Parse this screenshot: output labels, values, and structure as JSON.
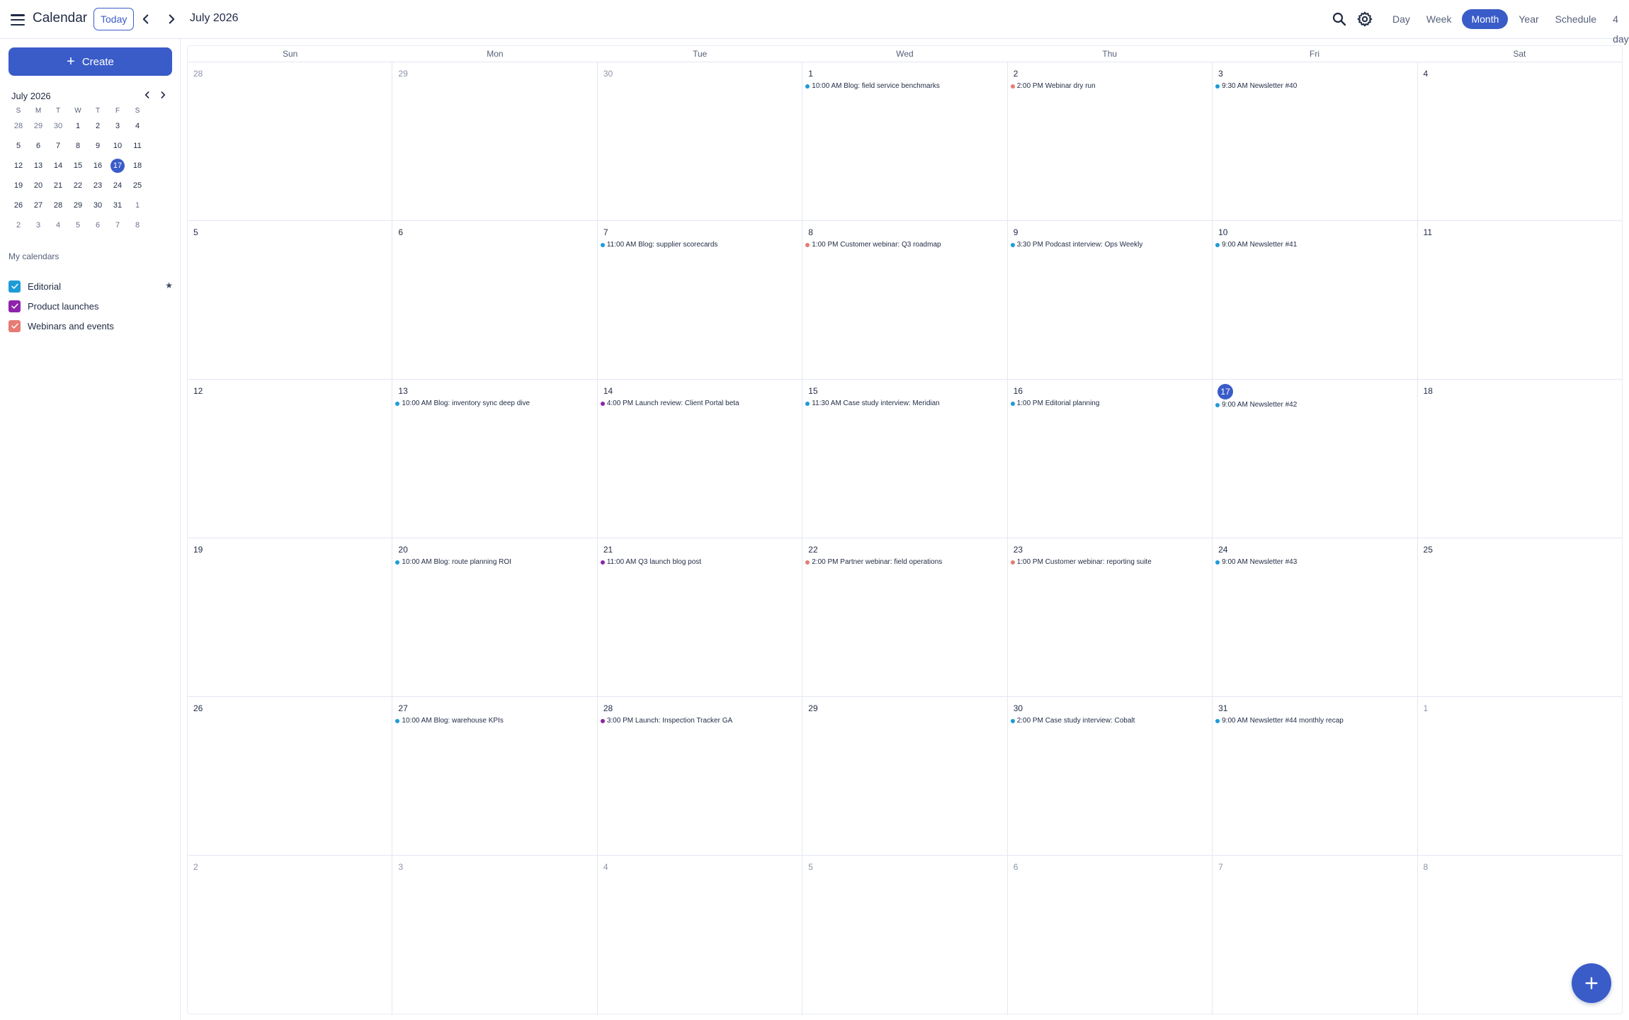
{
  "header": {
    "app_title": "Calendar",
    "today_label": "Today",
    "month_title": "July 2026",
    "views": [
      "Day",
      "Week",
      "Month",
      "Year",
      "Schedule",
      "4 days"
    ],
    "active_view": "Month"
  },
  "sidebar": {
    "create_label": "Create",
    "mini_title": "July 2026",
    "mini_dow": [
      "S",
      "M",
      "T",
      "W",
      "T",
      "F",
      "S"
    ],
    "mini_weeks": [
      [
        "28",
        "29",
        "30",
        "1",
        "2",
        "3",
        "4"
      ],
      [
        "5",
        "6",
        "7",
        "8",
        "9",
        "10",
        "11"
      ],
      [
        "12",
        "13",
        "14",
        "15",
        "16",
        "17",
        "18"
      ],
      [
        "19",
        "20",
        "21",
        "22",
        "23",
        "24",
        "25"
      ],
      [
        "26",
        "27",
        "28",
        "29",
        "30",
        "31",
        "1"
      ],
      [
        "2",
        "3",
        "4",
        "5",
        "6",
        "7",
        "8"
      ]
    ],
    "mini_today": "17",
    "my_calendars_title": "My calendars",
    "calendars": [
      {
        "name": "Editorial",
        "color": "#1e9bd7",
        "starred": true
      },
      {
        "name": "Product launches",
        "color": "#8e24aa",
        "starred": false
      },
      {
        "name": "Webinars and events",
        "color": "#e67c73",
        "starred": false
      }
    ]
  },
  "colors": {
    "accent": "#3a5cc9",
    "editorial": "#1e9bd7",
    "product": "#8e24aa",
    "webinar": "#e67c73"
  },
  "month": {
    "dow": [
      "Sun",
      "Mon",
      "Tue",
      "Wed",
      "Thu",
      "Fri",
      "Sat"
    ],
    "today": "17",
    "weeks": [
      [
        {
          "d": "28",
          "out": true,
          "events": []
        },
        {
          "d": "29",
          "out": true,
          "events": []
        },
        {
          "d": "30",
          "out": true,
          "events": []
        },
        {
          "d": "1",
          "events": [
            {
              "text": "10:00 AM Blog: field service benchmarks",
              "cal": "editorial"
            }
          ]
        },
        {
          "d": "2",
          "events": [
            {
              "text": "2:00 PM Webinar dry run",
              "cal": "webinar"
            }
          ]
        },
        {
          "d": "3",
          "events": [
            {
              "text": "9:30 AM Newsletter #40",
              "cal": "editorial"
            }
          ]
        },
        {
          "d": "4",
          "events": []
        }
      ],
      [
        {
          "d": "5",
          "events": []
        },
        {
          "d": "6",
          "events": []
        },
        {
          "d": "7",
          "events": [
            {
              "text": "11:00 AM Blog: supplier scorecards",
              "cal": "editorial"
            }
          ]
        },
        {
          "d": "8",
          "events": [
            {
              "text": "1:00 PM Customer webinar: Q3 roadmap",
              "cal": "webinar"
            }
          ]
        },
        {
          "d": "9",
          "events": [
            {
              "text": "3:30 PM Podcast interview: Ops Weekly",
              "cal": "editorial"
            }
          ]
        },
        {
          "d": "10",
          "events": [
            {
              "text": "9:00 AM Newsletter #41",
              "cal": "editorial"
            }
          ]
        },
        {
          "d": "11",
          "events": []
        }
      ],
      [
        {
          "d": "12",
          "events": []
        },
        {
          "d": "13",
          "events": [
            {
              "text": "10:00 AM Blog: inventory sync deep dive",
              "cal": "editorial"
            }
          ]
        },
        {
          "d": "14",
          "events": [
            {
              "text": "4:00 PM Launch review: Client Portal beta",
              "cal": "product"
            }
          ]
        },
        {
          "d": "15",
          "events": [
            {
              "text": "11:30 AM Case study interview: Meridian",
              "cal": "editorial"
            }
          ]
        },
        {
          "d": "16",
          "events": [
            {
              "text": "1:00 PM Editorial planning",
              "cal": "editorial"
            }
          ]
        },
        {
          "d": "17",
          "today": true,
          "events": [
            {
              "text": "9:00 AM Newsletter #42",
              "cal": "editorial"
            }
          ]
        },
        {
          "d": "18",
          "events": []
        }
      ],
      [
        {
          "d": "19",
          "events": []
        },
        {
          "d": "20",
          "events": [
            {
              "text": "10:00 AM Blog: route planning ROI",
              "cal": "editorial"
            }
          ]
        },
        {
          "d": "21",
          "events": [
            {
              "text": "11:00 AM Q3 launch blog post",
              "cal": "product"
            }
          ]
        },
        {
          "d": "22",
          "events": [
            {
              "text": "2:00 PM Partner webinar: field operations",
              "cal": "webinar"
            }
          ]
        },
        {
          "d": "23",
          "events": [
            {
              "text": "1:00 PM Customer webinar: reporting suite",
              "cal": "webinar"
            }
          ]
        },
        {
          "d": "24",
          "events": [
            {
              "text": "9:00 AM Newsletter #43",
              "cal": "editorial"
            }
          ]
        },
        {
          "d": "25",
          "events": []
        }
      ],
      [
        {
          "d": "26",
          "events": []
        },
        {
          "d": "27",
          "events": [
            {
              "text": "10:00 AM Blog: warehouse KPIs",
              "cal": "editorial"
            }
          ]
        },
        {
          "d": "28",
          "events": [
            {
              "text": "3:00 PM Launch: Inspection Tracker GA",
              "cal": "product"
            }
          ]
        },
        {
          "d": "29",
          "events": []
        },
        {
          "d": "30",
          "events": [
            {
              "text": "2:00 PM Case study interview: Cobalt",
              "cal": "editorial"
            }
          ]
        },
        {
          "d": "31",
          "events": [
            {
              "text": "9:00 AM Newsletter #44 monthly recap",
              "cal": "editorial"
            }
          ]
        },
        {
          "d": "1",
          "out": true,
          "events": []
        }
      ],
      [
        {
          "d": "2",
          "out": true,
          "events": []
        },
        {
          "d": "3",
          "out": true,
          "events": []
        },
        {
          "d": "4",
          "out": true,
          "events": []
        },
        {
          "d": "5",
          "out": true,
          "events": []
        },
        {
          "d": "6",
          "out": true,
          "events": []
        },
        {
          "d": "7",
          "out": true,
          "events": []
        },
        {
          "d": "8",
          "out": true,
          "events": []
        }
      ]
    ]
  }
}
